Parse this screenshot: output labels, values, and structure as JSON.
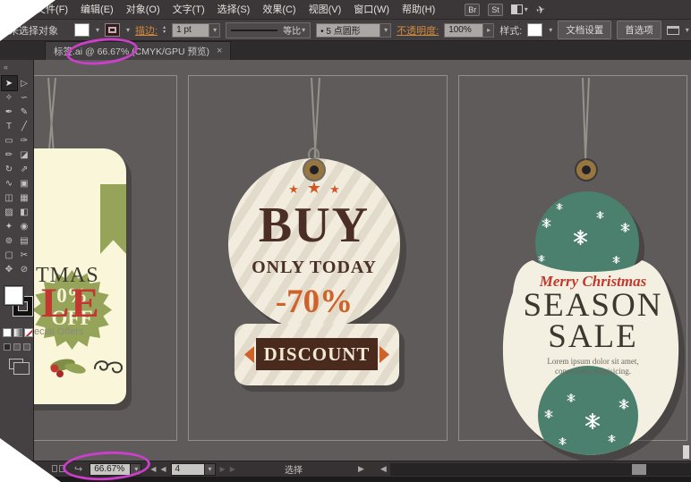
{
  "menu": {
    "items": [
      "文件(F)",
      "编辑(E)",
      "对象(O)",
      "文字(T)",
      "选择(S)",
      "效果(C)",
      "视图(V)",
      "窗口(W)",
      "帮助(H)"
    ],
    "bridge": "Br",
    "stock": "St",
    "gpu_icon": "✈"
  },
  "control": {
    "no_selection": "未选择对象",
    "stroke_label": "描边:",
    "stroke_value": "1 pt",
    "stepper_up": "▴",
    "stepper_down": "▾",
    "profile_label": "等比",
    "brush_label": "• 5 点圆形",
    "opacity_label": "不透明度:",
    "opacity_value": "100%",
    "opacity_arrow": "▸",
    "style_label": "样式:",
    "doc_setup": "文档设置",
    "preferences": "首选项",
    "dropdown_glyph": "▾"
  },
  "tab": {
    "title": "标签.ai @ 66.67% (CMYK/GPU 预览)",
    "close": "×",
    "collapse": "«"
  },
  "tools": [
    {
      "name": "selection-tool",
      "glyph": "➤",
      "active": true
    },
    {
      "name": "direct-selection-tool",
      "glyph": "▷"
    },
    {
      "name": "magic-wand-tool",
      "glyph": "✧"
    },
    {
      "name": "lasso-tool",
      "glyph": "∽"
    },
    {
      "name": "pen-tool",
      "glyph": "✒"
    },
    {
      "name": "curvature-tool",
      "glyph": "✎"
    },
    {
      "name": "type-tool",
      "glyph": "T"
    },
    {
      "name": "line-segment-tool",
      "glyph": "╱"
    },
    {
      "name": "rectangle-tool",
      "glyph": "▭"
    },
    {
      "name": "paintbrush-tool",
      "glyph": "✑"
    },
    {
      "name": "pencil-tool",
      "glyph": "✏"
    },
    {
      "name": "eraser-tool",
      "glyph": "◪"
    },
    {
      "name": "rotate-tool",
      "glyph": "↻"
    },
    {
      "name": "scale-tool",
      "glyph": "⇗"
    },
    {
      "name": "width-tool",
      "glyph": "∿"
    },
    {
      "name": "free-transform-tool",
      "glyph": "▣"
    },
    {
      "name": "shape-builder-tool",
      "glyph": "◫"
    },
    {
      "name": "perspective-grid-tool",
      "glyph": "▦"
    },
    {
      "name": "mesh-tool",
      "glyph": "▨"
    },
    {
      "name": "gradient-tool",
      "glyph": "◧"
    },
    {
      "name": "eyedropper-tool",
      "glyph": "✦"
    },
    {
      "name": "blend-tool",
      "glyph": "◉"
    },
    {
      "name": "symbol-sprayer-tool",
      "glyph": "⊚"
    },
    {
      "name": "column-graph-tool",
      "glyph": "▤"
    },
    {
      "name": "artboard-tool",
      "glyph": "▢"
    },
    {
      "name": "slice-tool",
      "glyph": "✂"
    },
    {
      "name": "hand-tool",
      "glyph": "✥"
    },
    {
      "name": "zoom-tool",
      "glyph": "⊘"
    }
  ],
  "canvas": {
    "tags": {
      "left": {
        "badge_line1": "0%",
        "badge_line2": "OFF",
        "title_fragment": "TMAS",
        "sale_fragment": "LE",
        "subtitle_fragment": "ecial Offers"
      },
      "middle": {
        "stars": [
          "★",
          "★",
          "★"
        ],
        "line1": "BUY",
        "line2": "ONLY TODAY",
        "line3": "-70%",
        "line4": "DISCOUNT"
      },
      "right": {
        "script": "Merry Christmas",
        "line1": "SEASON",
        "line2": "SALE",
        "body1": "Lorem ipsum dolor sit amet,",
        "body2": "consectetur adipisicing.",
        "snowflakes_top": [
          [
            605,
            175,
            11
          ],
          [
            640,
            190,
            17
          ],
          [
            666,
            165,
            9
          ],
          [
            693,
            180,
            11
          ],
          [
            621,
            155,
            8
          ],
          [
            684,
            215,
            9
          ],
          [
            601,
            213,
            8
          ]
        ],
        "snowflakes_bottom": [
          [
            653,
            395,
            18
          ],
          [
            633,
            370,
            10
          ],
          [
            691,
            378,
            12
          ],
          [
            608,
            388,
            10
          ],
          [
            624,
            418,
            9
          ],
          [
            679,
            415,
            9
          ]
        ]
      }
    }
  },
  "statusbar": {
    "flick_icon": "↪",
    "zoom": "66.67%",
    "first_arrow": "◀",
    "prev_arrow": "◀",
    "artboard_number": "4",
    "next_arrow": "▶",
    "last_arrow": "▶",
    "status_label": "选择",
    "right_arrow": "▶",
    "left_arrow": "◀",
    "dropdown_glyph": "▾"
  },
  "colors": {
    "annotation_magenta": "#cb3fcb",
    "cream": "#f1ecdd",
    "dark_brown": "#4b2f27",
    "orange": "#cf6229",
    "olive_green": "#96a459",
    "teal_green": "#4b7f6e",
    "red": "#c23730",
    "canvas_grey": "#5f5b5b"
  }
}
